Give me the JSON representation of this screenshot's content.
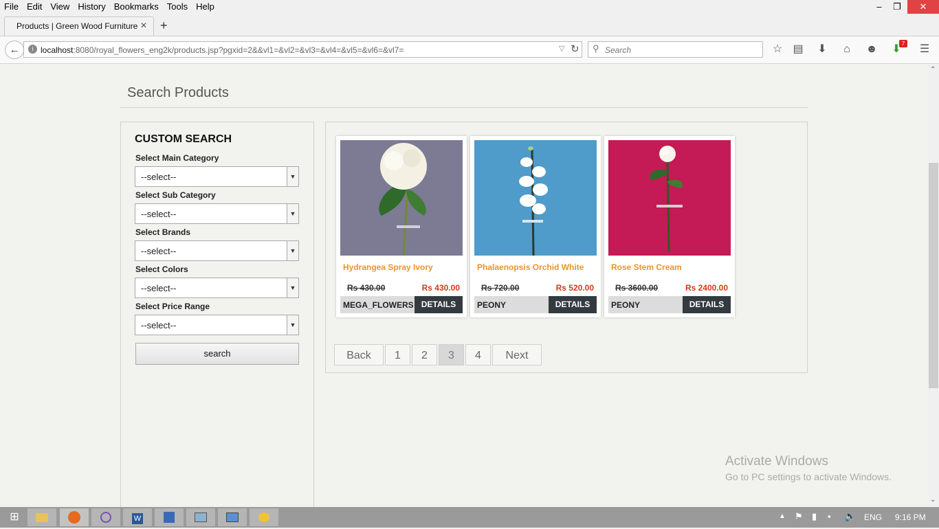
{
  "menu": [
    "File",
    "Edit",
    "View",
    "History",
    "Bookmarks",
    "Tools",
    "Help"
  ],
  "tab": {
    "title": "Products | Green Wood Furniture"
  },
  "url": {
    "host": "localhost",
    "rest": ":8080/royal_flowers_eng2k/products.jsp?pgxid=2&&vl1=&vl2=&vl3=&vl4=&vl5=&vl6=&vl7="
  },
  "search_bar": {
    "placeholder": "Search"
  },
  "download_badge": "7",
  "page": {
    "title": "Search Products"
  },
  "filters": {
    "heading": "CUSTOM SEARCH",
    "fields": [
      {
        "label": "Select Main Category",
        "value": "--select--"
      },
      {
        "label": "Select Sub Category",
        "value": "--select--"
      },
      {
        "label": "Select Brands",
        "value": "--select--"
      },
      {
        "label": "Select Colors",
        "value": "--select--"
      },
      {
        "label": "Select Price Range",
        "value": "--select--"
      }
    ],
    "search_button": "search"
  },
  "products": [
    {
      "name": "Hydrangea Spray Ivory",
      "old_price": "Rs 430.00",
      "price": "Rs 430.00",
      "brand": "MEGA_FLOWERS",
      "details": "DETAILS",
      "bg": "#7d7a94",
      "flower": "#f4f1e4"
    },
    {
      "name": "Phalaenopsis Orchid White",
      "old_price": "Rs 720.00",
      "price": "Rs 520.00",
      "brand": "PEONY",
      "details": "DETAILS",
      "bg": "#4f9bc9",
      "flower": "#ffffff"
    },
    {
      "name": "Rose Stem Cream",
      "old_price": "Rs 3600.00",
      "price": "Rs 2400.00",
      "brand": "PEONY",
      "details": "DETAILS",
      "bg": "#c41a55",
      "flower": "#f7f3ea"
    }
  ],
  "pagination": {
    "back": "Back",
    "pages": [
      "1",
      "2",
      "3",
      "4"
    ],
    "active": "3",
    "next": "Next"
  },
  "watermark": {
    "line1": "Activate Windows",
    "line2": "Go to PC settings to activate Windows."
  },
  "taskbar": {
    "lang": "ENG",
    "time": "9:16 PM"
  }
}
